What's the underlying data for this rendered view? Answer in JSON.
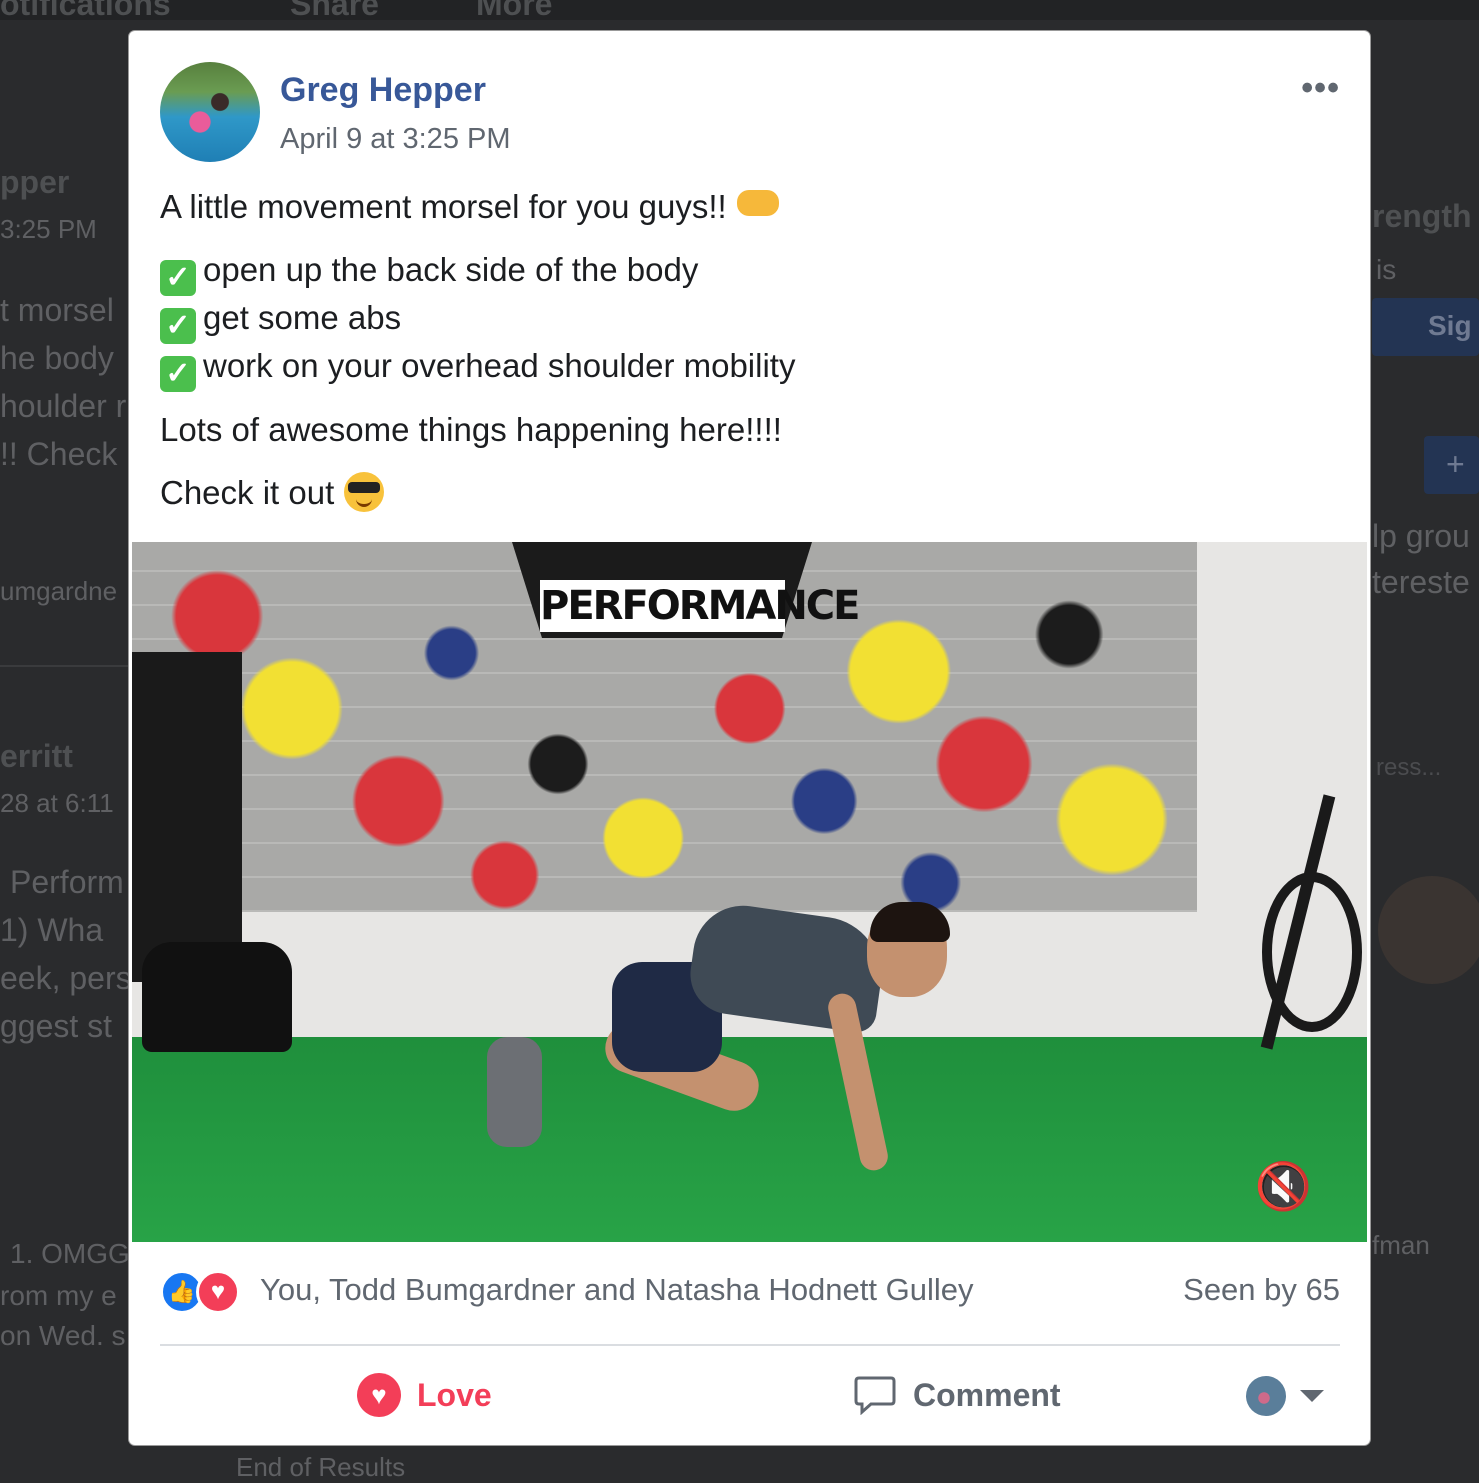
{
  "background": {
    "top_tabs": [
      "otifications",
      "Share",
      "More"
    ],
    "left_fragments": [
      "pper",
      "3:25 PM",
      "t morsel",
      "he body",
      "houlder r",
      "!! Check",
      "umgardne",
      "erritt",
      "28 at 6:11",
      "Perform",
      "1) Wha",
      "eek, pers",
      "ggest st",
      "1. OMGG",
      "rom my e",
      "on Wed. s"
    ],
    "right_fragments": [
      "rength",
      "is",
      "Sig",
      "+",
      "lp grou",
      "tereste",
      "ress...",
      "fman"
    ],
    "footer_fragment": "End of Results"
  },
  "post": {
    "author": "Greg Hepper",
    "timestamp": "April 9 at 3:25 PM",
    "more_label": "•••",
    "lines": [
      "A little movement morsel for you guys!!",
      "open up the back side of the body",
      "get some abs",
      "work on your overhead shoulder mobility",
      "Lots of awesome things happening here!!!!",
      "Check it out"
    ],
    "check_glyph": "✓"
  },
  "video": {
    "logo_text": "PERFORMANCE",
    "mute_icon": "🔇"
  },
  "reactions": {
    "like_glyph": "👍",
    "love_glyph": "♥",
    "names": "You, Todd Bumgardner and Natasha Hodnett Gulley",
    "seen": "Seen by 65"
  },
  "actions": {
    "love_label": "Love",
    "love_glyph": "♥",
    "comment_label": "Comment"
  },
  "colors": {
    "name_blue": "#385898",
    "love_red": "#f33e58",
    "like_blue": "#1877f2",
    "check_green": "#4bbf4d"
  }
}
